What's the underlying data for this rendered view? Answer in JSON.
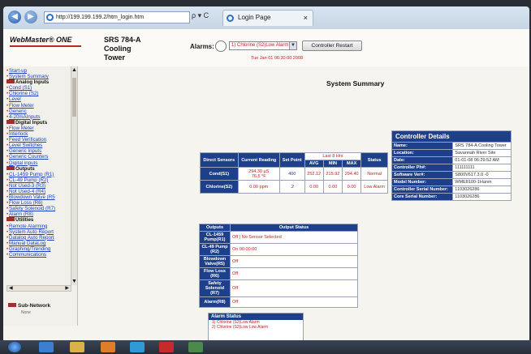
{
  "browser": {
    "url": "http://199.199.199.2/htm_login.htm",
    "search_glyph": "ρ ▾ C",
    "tab_title": "Login Page",
    "back_glyph": "◀",
    "forward_glyph": "▶",
    "close_glyph": "×"
  },
  "header": {
    "logo": "WebMaster® ONE",
    "model_line1": "SRS 784-A",
    "model_line2": "Cooling",
    "model_line3": "Tower",
    "alarms_label": "Alarms:",
    "alarm_select_value": "1) Chlorine (S2)Low Alarm",
    "restart_label": "Controller Restart",
    "datetime": "Tue Jan 01 06:30:00 2008"
  },
  "sidebar": {
    "items": [
      {
        "type": "link",
        "label": "Start-up"
      },
      {
        "type": "link",
        "label": "System Summary"
      },
      {
        "type": "section",
        "label": "Analog Inputs"
      },
      {
        "type": "link",
        "label": "Cond (S1)"
      },
      {
        "type": "link",
        "label": "Chlorine (S2)"
      },
      {
        "type": "link",
        "label": "Level"
      },
      {
        "type": "link",
        "label": "Flow Meter"
      },
      {
        "type": "link",
        "label": "Generic"
      },
      {
        "type": "link",
        "label": "4-20mAInputs"
      },
      {
        "type": "section",
        "label": "Digital Inputs"
      },
      {
        "type": "link",
        "label": "Flow Meter"
      },
      {
        "type": "link",
        "label": "Interlock"
      },
      {
        "type": "link",
        "label": "Feed Verification"
      },
      {
        "type": "link",
        "label": "Level Switches"
      },
      {
        "type": "link",
        "label": "Generic Inputs"
      },
      {
        "type": "link",
        "label": "Generic Counters"
      },
      {
        "type": "link",
        "label": "Digital inputs"
      },
      {
        "type": "section",
        "label": "Outputs"
      },
      {
        "type": "link",
        "label": "CL-1459 Pump (R1)"
      },
      {
        "type": "link",
        "label": "CL-49 Pump (R2)"
      },
      {
        "type": "link",
        "label": "Not Used-3 (R3)"
      },
      {
        "type": "link",
        "label": "Not Used-4 (R4)"
      },
      {
        "type": "link",
        "label": "Blowdown Valve (R5"
      },
      {
        "type": "link",
        "label": "Flow Loss (R6)"
      },
      {
        "type": "link",
        "label": "Safety Solenoid (R7)"
      },
      {
        "type": "link",
        "label": "Alarm (R8)"
      },
      {
        "type": "section",
        "label": "Utilities"
      },
      {
        "type": "link",
        "label": "Remote Alarming"
      },
      {
        "type": "link",
        "label": "System Auto Report"
      },
      {
        "type": "link",
        "label": "Datalog Auto Report"
      },
      {
        "type": "link",
        "label": "Manual DataLog"
      },
      {
        "type": "link",
        "label": "Graphing/Trending"
      },
      {
        "type": "link",
        "label": "Communications"
      }
    ],
    "subnet_label": "Sub-Network",
    "subnet_sub": "None"
  },
  "summary": {
    "title": "System Summary",
    "direct": {
      "headers": [
        "Direct Sensors",
        "Current Reading",
        "Set Point",
        "Last 8 Hrs",
        "Status"
      ],
      "sub_headers": [
        "AVG",
        "MIN",
        "MAX"
      ],
      "rows": [
        {
          "name": "Cond(S1)",
          "reading": "294.30 µS",
          "reading2": "76.5 °F",
          "setpoint": "400",
          "avg": "252.12",
          "min": "215.92",
          "max": "294.40",
          "status": "Normal"
        },
        {
          "name": "Chlorine(S2)",
          "reading": "0.00 ppm",
          "reading2": "",
          "setpoint": ".2",
          "avg": "0.00",
          "min": "0.00",
          "max": "0.00",
          "status": "Low Alarm"
        }
      ]
    },
    "controller": {
      "title": "Controller Details",
      "rows": [
        {
          "k": "Name:",
          "v": "SRS 784-A Cooling Tower"
        },
        {
          "k": "Location:",
          "v": "Savannah River Site"
        },
        {
          "k": "Date:",
          "v": "01-01-08 06:29:52 AM"
        },
        {
          "k": "Controller Ph#:",
          "v": "111111111"
        },
        {
          "k": "Software Ver#:",
          "v": "S800V617.3.0 -0"
        },
        {
          "k": "Model Number:",
          "v": "WME8100-1Hanm"
        },
        {
          "k": "Controller Serial Number:",
          "v": "1103026286"
        },
        {
          "k": "Core Serial Number:",
          "v": "1103026286"
        }
      ]
    },
    "outputs": {
      "headers": [
        "Outputs",
        "Output Status"
      ],
      "rows": [
        {
          "name": "CL-1459 Pump(R1)",
          "status": "Off | No Sensor Selected"
        },
        {
          "name": "CL-49 Pump (R2)",
          "status": "On 00:00:00"
        },
        {
          "name": "Blowdown Valve(R5)",
          "status": "Off"
        },
        {
          "name": "Flow Loss (R6)",
          "status": "Off"
        },
        {
          "name": "Safety Solenoid (R7)",
          "status": "Off"
        },
        {
          "name": "Alarm(R8)",
          "status": "Off"
        }
      ]
    },
    "alarm_status": {
      "title": "Alarm Status",
      "lines": [
        "1) Chlorine (S2)Low Alarm",
        "2) Chlorine (S2)Low Low Alarm"
      ]
    }
  },
  "colors": {
    "accent": "#1e3f8a",
    "alarm_text": "#c31c1c"
  },
  "taskbar": {
    "icons": [
      "start-orb-icon",
      "ie-icon",
      "folder-icon",
      "media-icon",
      "hp-icon",
      "acrobat-icon",
      "app-icon"
    ]
  }
}
